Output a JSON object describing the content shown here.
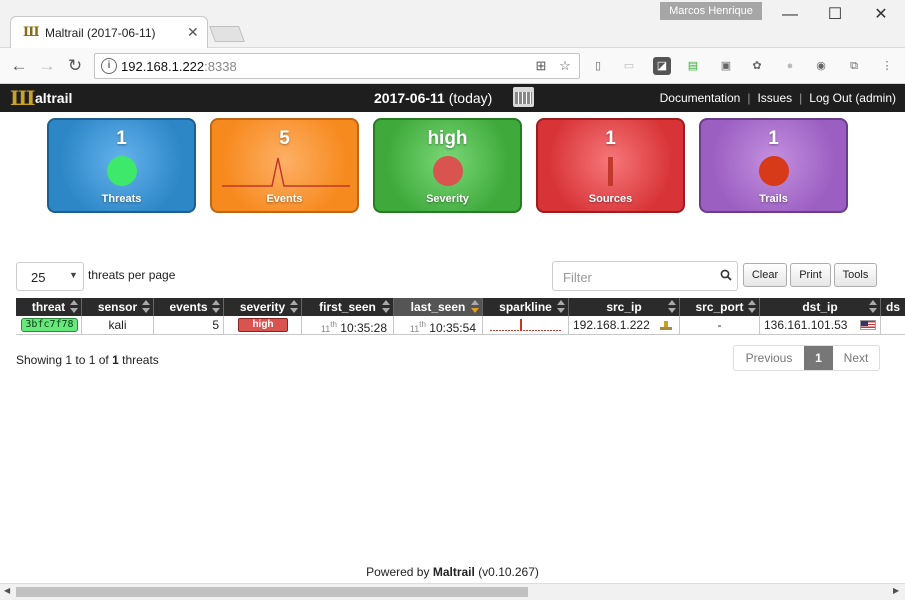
{
  "browser": {
    "tab_title": "Maltrail (2017-06-11)",
    "user_badge": "Marcos Henrique",
    "url_host": "192.168.1.222",
    "url_port": ":8338"
  },
  "app": {
    "logo_text": "altrail",
    "date": "2017-06-11",
    "date_suffix": "(today)",
    "links": {
      "documentation": "Documentation",
      "issues": "Issues",
      "logout": "Log Out (admin)"
    }
  },
  "cards": [
    {
      "label": "Threats",
      "value": "1",
      "color": "#2d86c6"
    },
    {
      "label": "Events",
      "value": "5",
      "color": "#f78a1f"
    },
    {
      "label": "Severity",
      "value": "high",
      "color": "#3fa93c"
    },
    {
      "label": "Sources",
      "value": "1",
      "color": "#d83438"
    },
    {
      "label": "Trails",
      "value": "1",
      "color": "#9b5fc1"
    }
  ],
  "controls": {
    "page_length": "25",
    "page_length_label": "threats per page",
    "filter_placeholder": "Filter",
    "buttons": {
      "clear": "Clear",
      "print": "Print",
      "tools": "Tools"
    }
  },
  "table": {
    "columns": [
      "threat",
      "sensor",
      "events",
      "severity",
      "first_seen",
      "last_seen",
      "sparkline",
      "src_ip",
      "src_port",
      "dst_ip",
      "ds"
    ],
    "sorted_column": "last_seen",
    "rows": [
      {
        "threat": "3bfc7f78",
        "sensor": "kali",
        "events": "5",
        "severity": "high",
        "first_seen_day": "11",
        "first_seen_sup": "th",
        "first_seen_time": "10:35:28",
        "last_seen_day": "11",
        "last_seen_sup": "th",
        "last_seen_time": "10:35:54",
        "src_ip": "192.168.1.222",
        "src_port": "-",
        "dst_ip": "136.161.101.53"
      }
    ]
  },
  "info": {
    "prefix": "Showing 1 to 1 of",
    "total": "1",
    "suffix": "threats"
  },
  "pagination": {
    "previous": "Previous",
    "current": "1",
    "next": "Next"
  },
  "footer": {
    "prefix": "Powered by",
    "name": "Maltrail",
    "version": "(v0.10.267)"
  },
  "colors": {
    "accent_threat": "#66e87a",
    "severity_high": "#d9534f",
    "appbar": "#1e1e1e"
  }
}
